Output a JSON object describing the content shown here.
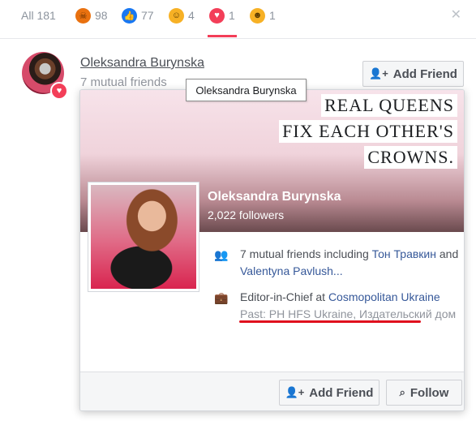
{
  "tabs": [
    {
      "label": "All 181"
    },
    {
      "icon": "angry-reaction-icon",
      "count": "98"
    },
    {
      "icon": "like-reaction-icon",
      "count": "77"
    },
    {
      "icon": "wow-reaction-icon",
      "count": "4"
    },
    {
      "icon": "love-reaction-icon",
      "count": "1"
    },
    {
      "icon": "haha-reaction-icon",
      "count": "1"
    }
  ],
  "colors": {
    "love": "#f33e58",
    "link": "#365899",
    "like": "#1877f2",
    "angry": "#e9710f",
    "wow": "#f7b125"
  },
  "row": {
    "name": "Oleksandra Burynska",
    "mutual": "7 mutual friends",
    "add_label": "Add Friend"
  },
  "tooltip": "Oleksandra Burynska",
  "card": {
    "quote": [
      "REAL QUEENS",
      "FIX EACH OTHER'S",
      "CROWNS."
    ],
    "name": "Oleksandra Burynska",
    "followers": "2,022 followers",
    "mutual_prefix": "7 mutual friends including ",
    "mutual_friend_1": "Тон Травкин",
    "mutual_and": " and ",
    "mutual_friend_2": "Valentyna Pavlush...",
    "job_prefix": "Editor-in-Chief at ",
    "job_company": "Cosmopolitan Ukraine",
    "past": "Past: PH HFS Ukraine, Издательский дом",
    "add_label": "Add Friend",
    "follow_label": "Follow"
  }
}
